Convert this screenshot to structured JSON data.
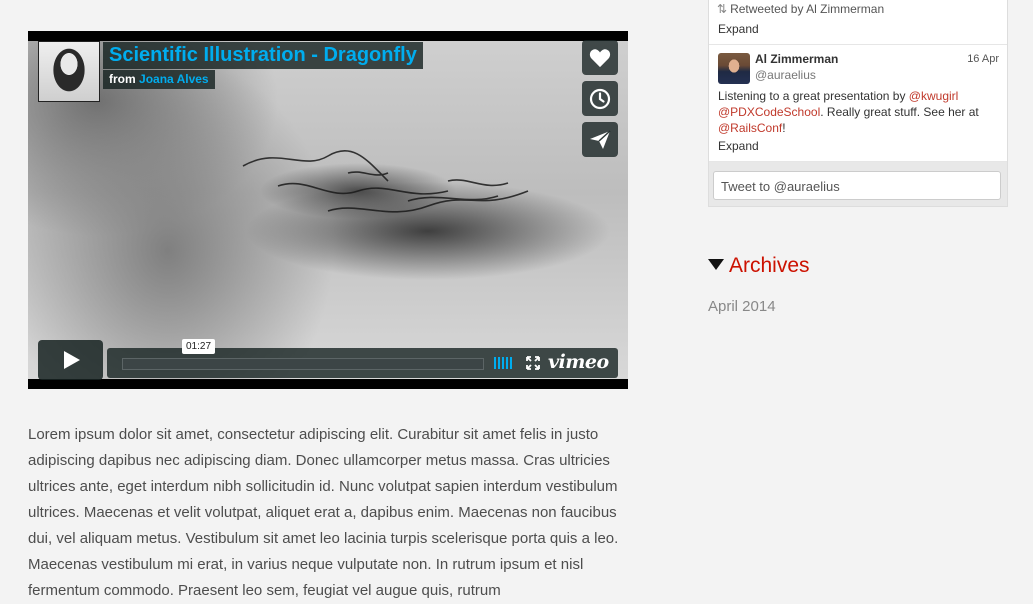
{
  "video": {
    "title": "Scientific Illustration - Dragonfly",
    "from_label": "from",
    "author": "Joana Alves",
    "timecode": "01:27",
    "brand": "vimeo",
    "buttons": [
      "heart-icon",
      "clock-icon",
      "send-icon"
    ]
  },
  "article": {
    "paragraph": "Lorem ipsum dolor sit amet, consectetur adipiscing elit. Curabitur sit amet felis in justo adipiscing dapibus nec adipiscing diam. Donec ullamcorper metus massa. Cras ultricies ultrices ante, eget interdum nibh sollicitudin id. Nunc volutpat sapien interdum vestibulum ultrices. Maecenas et velit volutpat, aliquet erat a, dapibus enim. Maecenas non faucibus dui, vel aliquam metus. Vestibulum sit amet leo lacinia turpis scelerisque porta quis a leo. Maecenas vestibulum mi erat, in varius neque vulputate non. In rutrum ipsum et nisl fermentum commodo. Praesent leo sem, feugiat vel augue quis, rutrum"
  },
  "twitter": {
    "retweet_line": "Retweeted by Al Zimmerman",
    "expand_label": "Expand",
    "tweet": {
      "name": "Al Zimmerman",
      "handle": "@auraelius",
      "date": "16 Apr",
      "text_1": "Listening to a great presentation by ",
      "mention_1": "@kwugirl",
      "mention_2": "@PDXCodeSchool",
      "text_2": ". Really great stuff. See her at ",
      "mention_3": "@RailsConf",
      "text_3": "!",
      "expand_label": "Expand"
    },
    "reply_placeholder": "Tweet to @auraelius"
  },
  "archives": {
    "heading": "Archives",
    "items": [
      "April 2014"
    ]
  },
  "colors": {
    "vimeo_blue": "#00adef",
    "link_red": "#cc1100"
  }
}
